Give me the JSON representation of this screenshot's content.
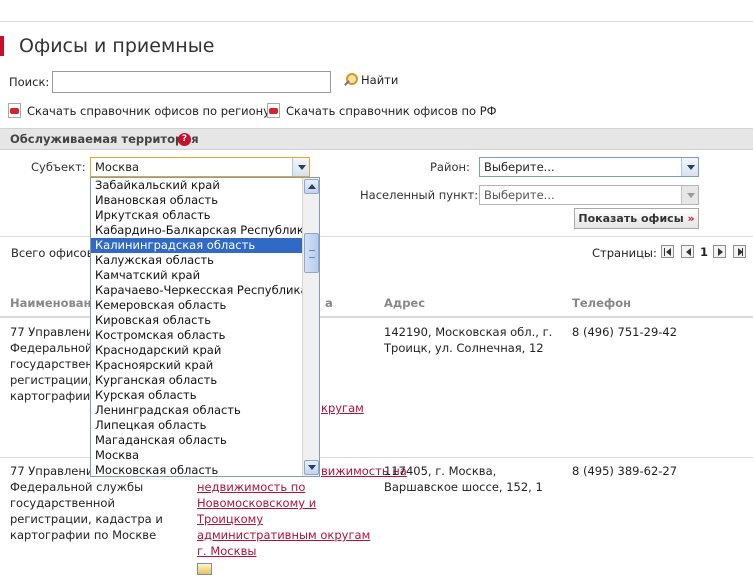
{
  "header": {
    "title": "Офисы и приемные"
  },
  "search": {
    "label": "Поиск:",
    "value": "",
    "button_label": "Найти",
    "icon": "magnifier-icon"
  },
  "downloads": [
    {
      "label": "Скачать справочник офисов по региону",
      "icon": "pdf-icon"
    },
    {
      "label": "Скачать справочник офисов по РФ",
      "icon": "pdf-icon"
    }
  ],
  "territory": {
    "title": "Обслуживаемая территория",
    "help_glyph": "?",
    "subject_label": "Субъект:",
    "subject_value": "Москва",
    "district_label": "Район:",
    "district_value": "Выберите...",
    "locality_label": "Населенный пункт:",
    "locality_value": "Выберите...",
    "show_button": "Показать офисы",
    "show_button_mark": "»"
  },
  "dropdown": {
    "selected_index": 4,
    "options": [
      "Забайкальский край",
      "Ивановская область",
      "Иркутская область",
      "Кабардино-Балкарская Республика",
      "Калининградская область",
      "Калужская область",
      "Камчатский край",
      "Карачаево-Черкесская Республика",
      "Кемеровская область",
      "Кировская область",
      "Костромская область",
      "Краснодарский край",
      "Красноярский край",
      "Курганская область",
      "Курская область",
      "Ленинградская область",
      "Липецкая область",
      "Магаданская область",
      "Москва",
      "Московская область"
    ]
  },
  "results": {
    "total_label": "Всего офисов",
    "pages_label": "Страницы:",
    "current_page": "1"
  },
  "table": {
    "headers": {
      "name": "Наименовани",
      "territory": "а",
      "address": "Адрес",
      "phone": "Телефон"
    },
    "rows": [
      {
        "name": [
          "77 Управлени",
          "Федеральной",
          "государственной",
          "регистрации, к",
          "картографии п"
        ],
        "territory_link": "кругам",
        "address": [
          "142190, Московская обл., г.",
          "Троицк, ул. Солнечная, 12"
        ],
        "phone": "8 (496) 751-29-42"
      },
      {
        "name": [
          "77 Управлени",
          "Федеральной службы",
          "государственной",
          "регистрации, кадастра и",
          "картографии по Москве"
        ],
        "territory_link": [
          "вижимость на",
          "недвижимость по",
          "Новомосковскому и",
          "Троицкому",
          "административным округам",
          "г. Москвы"
        ],
        "address": [
          "117405, г. Москва,",
          "Варшавское шоссе, 152, 1"
        ],
        "phone": "8 (495) 389-62-27"
      }
    ]
  },
  "colors": {
    "accent": "#c8102e",
    "link": "#b0123a",
    "selection": "#316ac5"
  }
}
